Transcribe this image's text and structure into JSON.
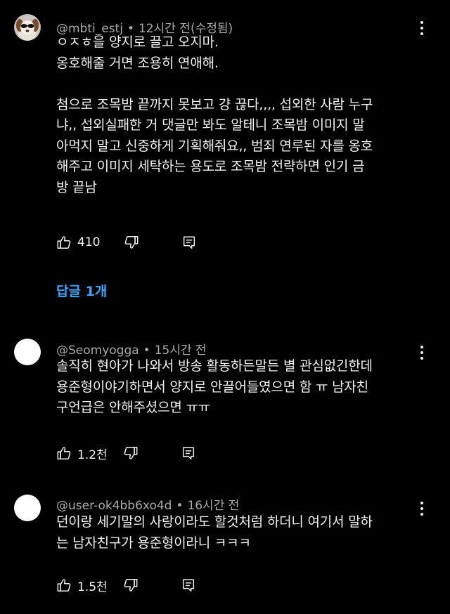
{
  "comments": [
    {
      "handle": "@mbti_estj",
      "time": "12시간 전(수정됨)",
      "text": "ㅇㅈㅎ을 양지로 끌고 오지마.\n옹호해줄 거면 조용히 연애해.\n\n첨으로 조목밤 끝까지 못보고 걍 끊다,,,, 섭외한 사람 누구\n냐,, 섭외실패한 거 댓글만 봐도 알테니 조목밤 이미지 말\n아먹지 말고 신중하게 기획해줘요,, 범죄 연루된 자를 옹호\n해주고 이미지 세탁하는 용도로 조목밤 전략하면 인기 금\n방 끝남",
      "likes": "410",
      "replies_label": "답글 1개"
    },
    {
      "handle": "@Seomyogga",
      "time": "15시간 전",
      "text": "솔직히 현아가 나와서 방송 활동하든말든 별 관심없긴한데\n용준형이야기하면서 양지로 안끌어들였으면 함 ㅠ 남자친\n구언급은 안해주셨으면 ㅠㅠ",
      "likes": "1.2천"
    },
    {
      "handle": "@user-ok4bb6xo4d",
      "time": "16시간 전",
      "text": "던이랑 세기말의 사랑이라도 할것처럼 하더니 여기서 말하\n는 남자친구가 용준형이라니 ㅋㅋㅋ",
      "likes": "1.5천"
    }
  ],
  "icons": {
    "like": "thumbs-up-icon",
    "dislike": "thumbs-down-icon",
    "reply": "reply-icon",
    "menu": "kebab-menu-icon"
  },
  "colors": {
    "background": "#000000",
    "text": "#f1f1f1",
    "meta": "#aaaaaa",
    "link": "#3ea6ff"
  }
}
